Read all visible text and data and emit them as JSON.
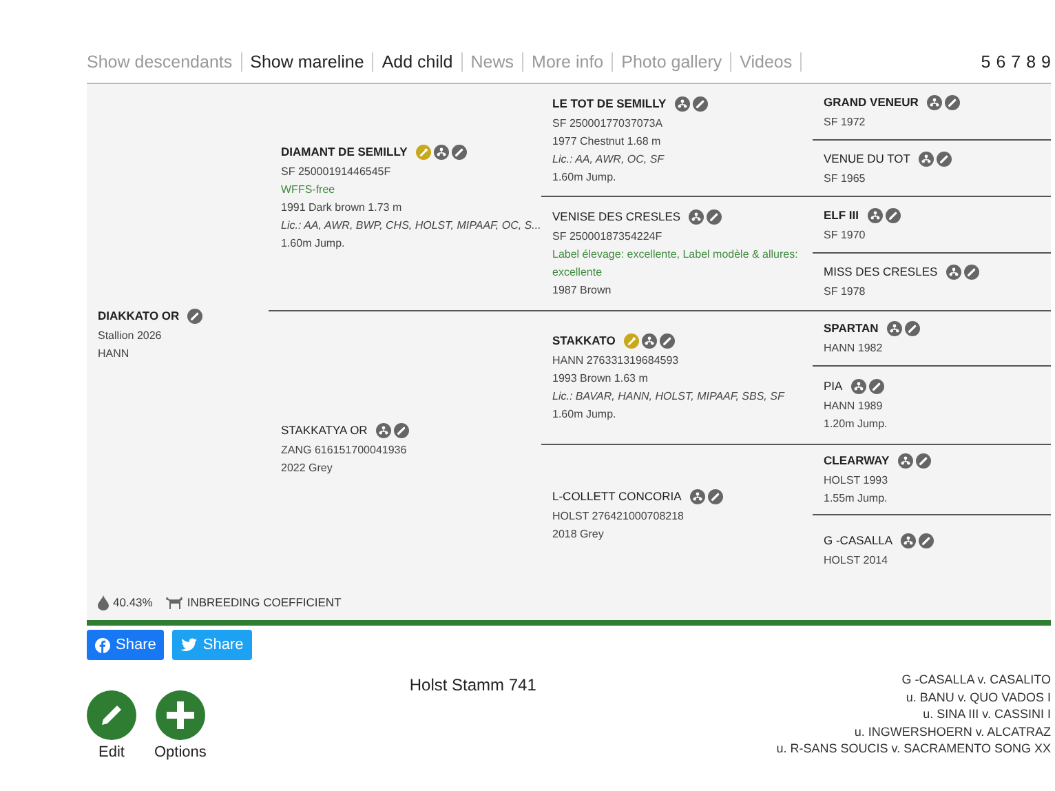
{
  "nav": {
    "links": [
      {
        "label": "Show descendants",
        "enabled": false
      },
      {
        "label": "Show mareline",
        "enabled": true
      },
      {
        "label": "Add child",
        "enabled": true
      },
      {
        "label": "News",
        "enabled": false
      },
      {
        "label": "More info",
        "enabled": false
      },
      {
        "label": "Photo gallery",
        "enabled": false
      },
      {
        "label": "Videos",
        "enabled": false
      }
    ],
    "generations": [
      "5",
      "6",
      "7",
      "8",
      "9"
    ]
  },
  "pedigree": {
    "columns": [
      [
        {
          "name": "DIAKKATO OR",
          "stallion": true,
          "licensed": false,
          "pedigree_link": false,
          "lines": [
            {
              "text": "Stallion 2026",
              "kind": "plain"
            },
            {
              "text": "HANN",
              "kind": "plain"
            }
          ]
        }
      ],
      [
        {
          "name": "DIAMANT DE SEMILLY",
          "stallion": true,
          "licensed": true,
          "pedigree_link": true,
          "lines": [
            {
              "text": "SF 25000191446545F",
              "kind": "plain"
            },
            {
              "text": "WFFS-free",
              "kind": "green"
            },
            {
              "text": "1991 Dark brown 1.73 m",
              "kind": "plain"
            },
            {
              "text": "Lic.: AA, AWR, BWP, CHS, HOLST, MIPAAF, OC, S...",
              "kind": "italic"
            },
            {
              "text": "1.60m Jump.",
              "kind": "plain"
            }
          ]
        },
        {
          "name": "STAKKATYA OR",
          "stallion": false,
          "licensed": false,
          "pedigree_link": true,
          "lines": [
            {
              "text": "ZANG 616151700041936",
              "kind": "plain"
            },
            {
              "text": "2022 Grey",
              "kind": "plain"
            }
          ]
        }
      ],
      [
        {
          "name": "LE TOT DE SEMILLY",
          "stallion": true,
          "licensed": false,
          "pedigree_link": true,
          "lines": [
            {
              "text": "SF 25000177037073A",
              "kind": "plain"
            },
            {
              "text": "1977 Chestnut 1.68 m",
              "kind": "plain"
            },
            {
              "text": "Lic.: AA, AWR, OC, SF",
              "kind": "italic"
            },
            {
              "text": "1.60m Jump.",
              "kind": "plain"
            }
          ]
        },
        {
          "name": "VENISE DES CRESLES",
          "stallion": false,
          "licensed": false,
          "pedigree_link": true,
          "lines": [
            {
              "text": "SF 25000187354224F",
              "kind": "plain"
            },
            {
              "text": "Label élevage: excellente, Label modèle & allures: excellente",
              "kind": "green"
            },
            {
              "text": "1987 Brown",
              "kind": "plain"
            }
          ]
        },
        {
          "name": "STAKKATO",
          "stallion": true,
          "licensed": true,
          "pedigree_link": true,
          "lines": [
            {
              "text": "HANN 276331319684593",
              "kind": "plain"
            },
            {
              "text": "1993 Brown 1.63 m",
              "kind": "plain"
            },
            {
              "text": "Lic.: BAVAR, HANN, HOLST, MIPAAF, SBS, SF",
              "kind": "italic"
            },
            {
              "text": "1.60m Jump.",
              "kind": "plain"
            }
          ]
        },
        {
          "name": "L-COLLETT CONCORIA",
          "stallion": false,
          "licensed": false,
          "pedigree_link": true,
          "lines": [
            {
              "text": "HOLST 276421000708218",
              "kind": "plain"
            },
            {
              "text": "2018 Grey",
              "kind": "plain"
            }
          ]
        }
      ],
      [
        {
          "name": "GRAND VENEUR",
          "stallion": true,
          "licensed": false,
          "pedigree_link": true,
          "lines": [
            {
              "text": "SF 1972",
              "kind": "plain"
            }
          ]
        },
        {
          "name": "VENUE DU TOT",
          "stallion": false,
          "licensed": false,
          "pedigree_link": true,
          "lines": [
            {
              "text": "SF 1965",
              "kind": "plain"
            }
          ]
        },
        {
          "name": "ELF III",
          "stallion": true,
          "licensed": false,
          "pedigree_link": true,
          "lines": [
            {
              "text": "SF 1970",
              "kind": "plain"
            }
          ]
        },
        {
          "name": "MISS DES CRESLES",
          "stallion": false,
          "licensed": false,
          "pedigree_link": true,
          "lines": [
            {
              "text": "SF 1978",
              "kind": "plain"
            }
          ]
        },
        {
          "name": "SPARTAN",
          "stallion": true,
          "licensed": false,
          "pedigree_link": true,
          "lines": [
            {
              "text": "HANN 1982",
              "kind": "plain"
            }
          ]
        },
        {
          "name": "PIA",
          "stallion": false,
          "licensed": false,
          "pedigree_link": true,
          "lines": [
            {
              "text": "HANN 1989",
              "kind": "plain"
            },
            {
              "text": "1.20m Jump.",
              "kind": "plain"
            }
          ]
        },
        {
          "name": "CLEARWAY",
          "stallion": true,
          "licensed": false,
          "pedigree_link": true,
          "lines": [
            {
              "text": "HOLST 1993",
              "kind": "plain"
            },
            {
              "text": "1.55m Jump.",
              "kind": "plain"
            }
          ]
        },
        {
          "name": "G -CASALLA",
          "stallion": false,
          "licensed": false,
          "pedigree_link": true,
          "lines": [
            {
              "text": "HOLST 2014",
              "kind": "plain"
            }
          ]
        }
      ]
    ],
    "inbreeding": {
      "value": "40.43%",
      "label": "INBREEDING COEFFICIENT"
    }
  },
  "share_buttons": [
    {
      "kind": "facebook",
      "label": "Share"
    },
    {
      "kind": "twitter",
      "label": "Share"
    }
  ],
  "mareline": {
    "title": "Holst Stamm 741",
    "lines": [
      "G -CASALLA v. CASALITO",
      "u. BANU v. QUO VADOS I",
      "u. SINA III v. CASSINI I",
      "u. INGWERSHOERN v. ALCATRAZ",
      "u. R-SANS SOUCIS v. SACRAMENTO SONG XX"
    ]
  },
  "actions": [
    {
      "kind": "edit",
      "label": "Edit"
    },
    {
      "kind": "options",
      "label": "Options"
    }
  ]
}
